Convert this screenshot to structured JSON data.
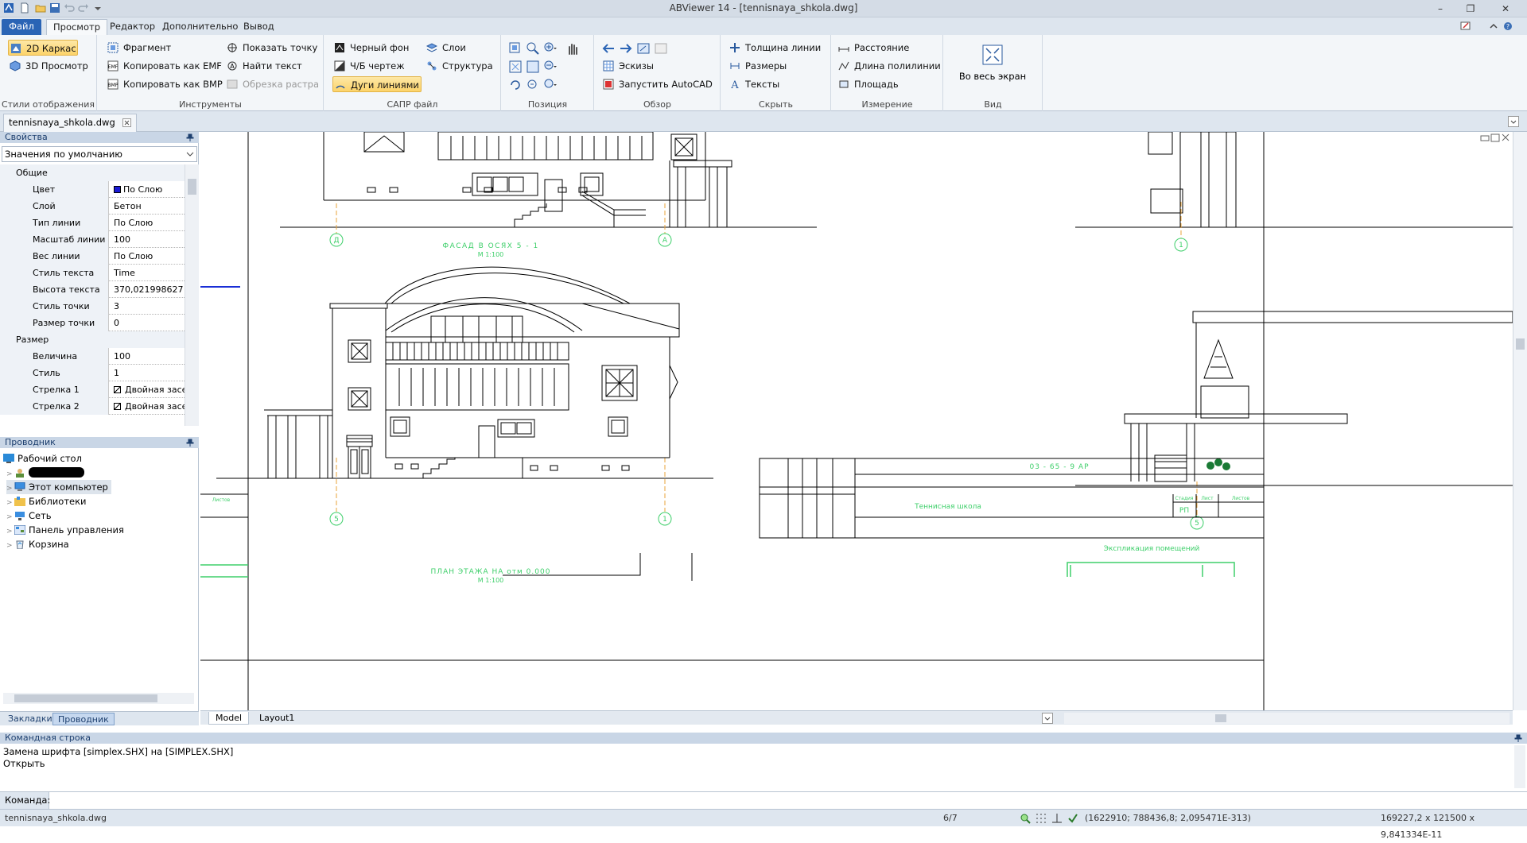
{
  "window": {
    "title": "ABViewer 14 - [tennisnaya_shkola.dwg]",
    "minimize": "–",
    "restore": "❐",
    "close": "✕"
  },
  "menu": {
    "file": "Файл",
    "tabs": [
      "Просмотр",
      "Редактор",
      "Дополнительно",
      "Вывод"
    ]
  },
  "ribbon": {
    "groups": {
      "display_styles": "Стили отображения",
      "tools": "Инструменты",
      "cad_file": "САПР файл",
      "position": "Позиция",
      "overview": "Обзор",
      "hide": "Скрыть",
      "measure": "Измерение",
      "view": "Вид"
    },
    "display_styles": {
      "wireframe_2d": "2D Каркас",
      "view_3d": "3D Просмотр"
    },
    "tools": {
      "fragment": "Фрагмент",
      "copy_emf": "Копировать как EMF",
      "copy_bmp": "Копировать как BMP",
      "show_point": "Показать точку",
      "find_text": "Найти текст",
      "raster_clip": "Обрезка растра"
    },
    "cad_file": {
      "black_bg": "Черный фон",
      "bw_drawing": "Ч/Б чертеж",
      "arcs_as_lines": "Дуги линиями",
      "layers": "Слои",
      "structure": "Структура"
    },
    "overview": {
      "sketches": "Эскизы",
      "launch_autocad": "Запустить AutoCAD"
    },
    "hide": {
      "line_weight": "Толщина линии",
      "dimensions": "Размеры",
      "texts": "Тексты"
    },
    "measure": {
      "distance": "Расстояние",
      "polyline_length": "Длина полилинии",
      "area": "Площадь"
    },
    "view": {
      "fullscreen": "Во весь экран"
    }
  },
  "document_tab": "tennisnaya_shkola.dwg",
  "properties": {
    "header": "Свойства",
    "preset": "Значения по умолчанию",
    "rows": [
      {
        "type": "cat",
        "name": "Общие",
        "value": ""
      },
      {
        "type": "prop",
        "name": "Цвет",
        "value": "По Слою"
      },
      {
        "type": "prop",
        "name": "Слой",
        "value": "Бетон"
      },
      {
        "type": "prop",
        "name": "Тип линии",
        "value": "По Слою"
      },
      {
        "type": "prop",
        "name": "Масштаб линии",
        "value": "100"
      },
      {
        "type": "prop",
        "name": "Вес линии",
        "value": "По Слою"
      },
      {
        "type": "prop",
        "name": "Стиль текста",
        "value": "Time"
      },
      {
        "type": "prop",
        "name": "Высота текста",
        "value": "370,021998627"
      },
      {
        "type": "prop",
        "name": "Стиль точки",
        "value": "3"
      },
      {
        "type": "prop",
        "name": "Размер точки",
        "value": "0"
      },
      {
        "type": "cat",
        "name": "Размер",
        "value": ""
      },
      {
        "type": "prop",
        "name": "Величина стрелки",
        "value": "100"
      },
      {
        "type": "prop",
        "name": "Стиль",
        "value": "1"
      },
      {
        "type": "prop",
        "name": "Стрелка 1",
        "value": "Двойная засе"
      },
      {
        "type": "prop",
        "name": "Стрелка 2",
        "value": "Двойная засе"
      }
    ]
  },
  "explorer": {
    "header": "Проводник",
    "items": [
      {
        "label": "Рабочий стол",
        "icon": "desktop-icon"
      },
      {
        "label": "",
        "icon": "user-icon"
      },
      {
        "label": "Этот компьютер",
        "icon": "computer-icon"
      },
      {
        "label": "Библиотеки",
        "icon": "libraries-icon"
      },
      {
        "label": "Сеть",
        "icon": "network-icon"
      },
      {
        "label": "Панель управления",
        "icon": "control-panel-icon"
      },
      {
        "label": "Корзина",
        "icon": "recycle-bin-icon"
      }
    ]
  },
  "left_tabs": [
    "Закладки",
    "Проводник"
  ],
  "layout_tabs": [
    "Model",
    "Layout1"
  ],
  "drawing_texts": {
    "facade_title": "ФАСАД В ОСЯХ 5 - 1",
    "facade_scale": "М 1:100",
    "plan_title": "ПЛАН ЭТАЖА НА отм 0.000",
    "plan_scale": "М 1:100",
    "stamp_code": "03 - 65 - 9  АР",
    "stamp_name": "Теннисная школа",
    "stamp_stage": "РП",
    "stamp_col1": "Стадия",
    "stamp_col2": "Лист",
    "stamp_col3": "Листов",
    "explication": "Экспликация помещений",
    "left_note": "Листов",
    "axis_labels": [
      "Д",
      "А",
      "1",
      "5",
      "1",
      "5"
    ]
  },
  "command": {
    "header": "Командная строка",
    "log": [
      "Замена шрифта [simplex.SHX] на [SIMPLEX.SHX]",
      "Открыть"
    ],
    "input_label": "Команда:"
  },
  "status": {
    "file": "tennisnaya_shkola.dwg",
    "page": "6/7",
    "coords": "(1622910; 788436,8; 2,095471E-313)",
    "size": "169227,2 x 121500 x 9,841334E-11"
  },
  "colors": {
    "accent": "#2a64b5",
    "selected": "#fcd36a",
    "drawing_green": "#3ecf6a",
    "axis_orange": "#e8a33a"
  }
}
